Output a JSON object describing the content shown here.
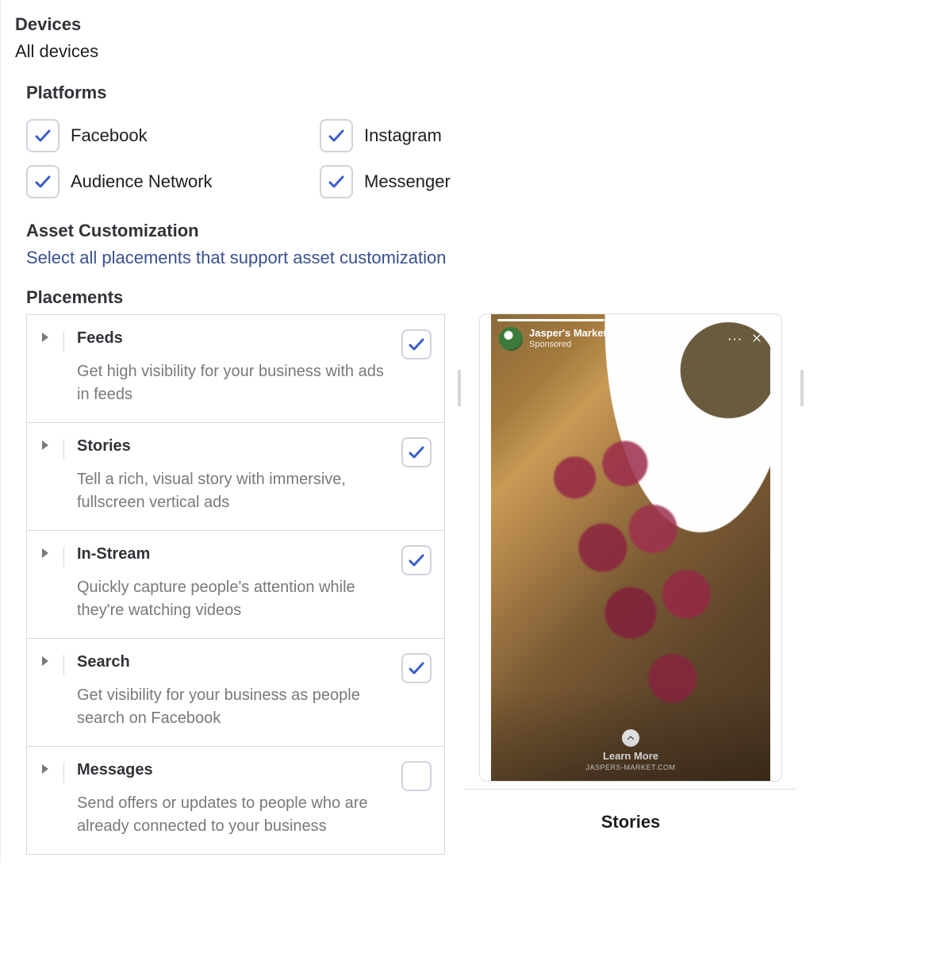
{
  "devices": {
    "heading": "Devices",
    "value": "All devices"
  },
  "platforms": {
    "heading": "Platforms",
    "items": [
      {
        "label": "Facebook",
        "checked": true
      },
      {
        "label": "Instagram",
        "checked": true
      },
      {
        "label": "Audience Network",
        "checked": true
      },
      {
        "label": "Messenger",
        "checked": true
      }
    ]
  },
  "asset": {
    "heading": "Asset Customization",
    "link": "Select all placements that support asset customization"
  },
  "placements": {
    "heading": "Placements",
    "items": [
      {
        "title": "Feeds",
        "desc": "Get high visibility for your business with ads in feeds",
        "checked": true
      },
      {
        "title": "Stories",
        "desc": "Tell a rich, visual story with immersive, fullscreen vertical ads",
        "checked": true
      },
      {
        "title": "In-Stream",
        "desc": "Quickly capture people's attention while they're watching videos",
        "checked": true
      },
      {
        "title": "Search",
        "desc": "Get visibility for your business as people search on Facebook",
        "checked": true
      },
      {
        "title": "Messages",
        "desc": "Send offers or updates to people who are already connected to your business",
        "checked": false
      }
    ]
  },
  "preview": {
    "brand": "Jasper's Market",
    "sponsored": "Sponsored",
    "cta": "Learn More",
    "url": "JASPERS-MARKET.COM",
    "caption": "Stories"
  }
}
